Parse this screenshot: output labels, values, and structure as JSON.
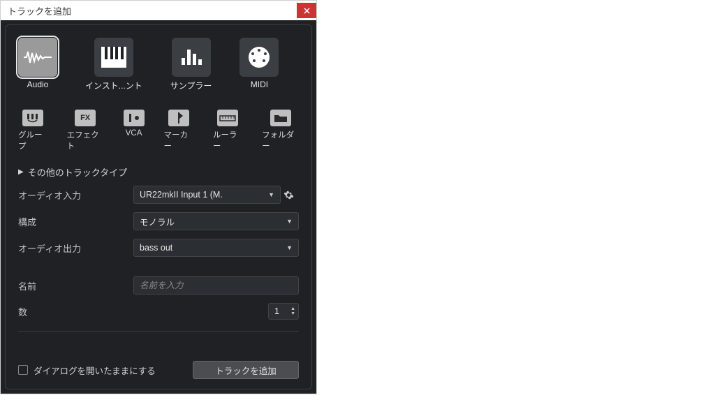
{
  "window": {
    "title": "トラックを追加"
  },
  "bigItems": [
    {
      "label": "Audio",
      "selected": true
    },
    {
      "label": "インスト...ント",
      "selected": false
    },
    {
      "label": "サンプラー",
      "selected": false
    },
    {
      "label": "MIDI",
      "selected": false
    }
  ],
  "smallItems": [
    {
      "label": "グループ"
    },
    {
      "label": "エフェクト"
    },
    {
      "label": "VCA"
    },
    {
      "label": "マーカー"
    },
    {
      "label": "ルーラー"
    },
    {
      "label": "フォルダー"
    }
  ],
  "expander": {
    "label": "その他のトラックタイプ"
  },
  "form": {
    "audioInLabel": "オーディオ入力",
    "audioInValue": "UR22mkII Input 1 (M.",
    "configLabel": "構成",
    "configValue": "モノラル",
    "audioOutLabel": "オーディオ出力",
    "audioOutValue": "bass out",
    "nameLabel": "名前",
    "namePlaceholder": "名前を入力",
    "countLabel": "数",
    "countValue": "1"
  },
  "footer": {
    "keepOpenLabel": "ダイアログを開いたままにする",
    "addLabel": "トラックを追加"
  }
}
